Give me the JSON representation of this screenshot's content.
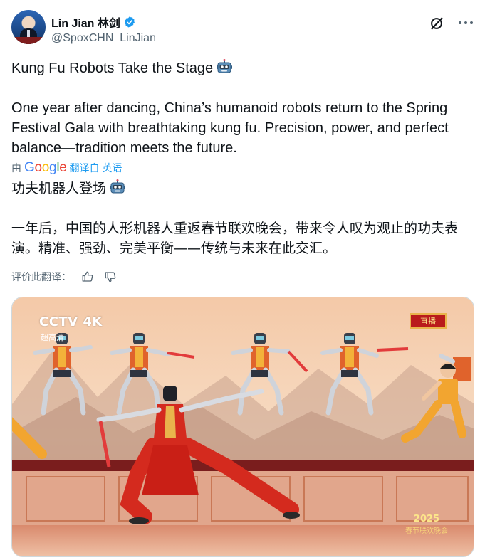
{
  "author": {
    "display_name": "Lin Jian 林剑",
    "handle": "@SpoxCHN_LinJian",
    "verified": true,
    "avatar_icon": "official-portrait-avatar"
  },
  "header_actions": {
    "grok_icon": "grok-icon",
    "more_icon": "more-options-icon"
  },
  "tweet": {
    "title": "Kung Fu Robots Take the Stage",
    "title_emoji": "robot-face",
    "body": "One year after dancing, China’s humanoid robots return to the Spring Festival Gala with breathtaking kung fu. Precision, power, and perfect balance—tradition meets the future."
  },
  "translation": {
    "by_prefix": "由",
    "provider": "Google",
    "link_text": "翻译自 英语",
    "title": "功夫机器人登场",
    "body": "一年后，中国的人形机器人重返春节联欢晚会，带来令人叹为观止的功夫表演。精准、强劲、完美平衡——传统与未来在此交汇。",
    "rate_label": "评价此翻译：",
    "thumbs_up_icon": "thumbs-up-icon",
    "thumbs_down_icon": "thumbs-down-icon"
  },
  "media": {
    "channel_logo": "CCTV 4K",
    "channel_sub": "超高清",
    "live_badge": "直播",
    "gala_year": "2025",
    "gala_name": "春节联欢晚会"
  },
  "colors": {
    "accent_link": "#1d9bf0",
    "secondary_text": "#536471",
    "primary_text": "#0f1419",
    "stage_red": "#c81e1e"
  }
}
